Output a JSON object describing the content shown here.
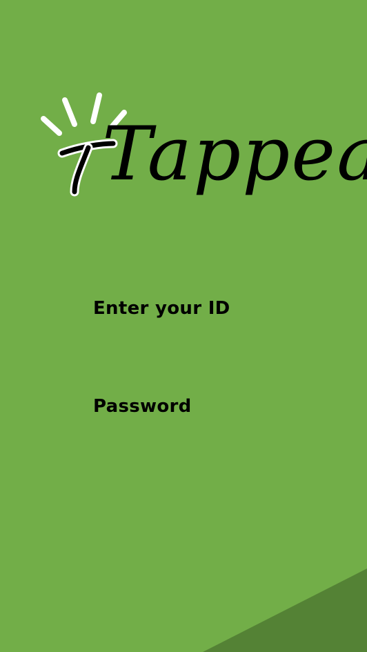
{
  "app": {
    "logo_text": "Tappeal"
  },
  "login": {
    "id_label": "Enter your ID",
    "id_value": "",
    "password_label": "Password",
    "password_value": ""
  },
  "colors": {
    "background": "#72ae48",
    "corner_accent": "#548235",
    "text": "#000000",
    "sparkle": "#ffffff"
  }
}
